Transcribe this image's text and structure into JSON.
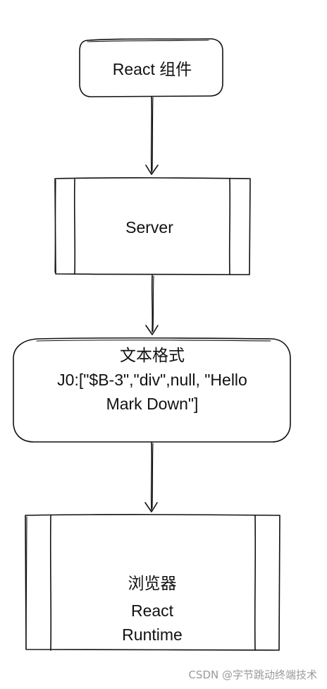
{
  "nodes": [
    {
      "id": "react-component",
      "shape": "rounded-rectangle",
      "lines": [
        "React 组件"
      ]
    },
    {
      "id": "server",
      "shape": "process",
      "lines": [
        "Server"
      ]
    },
    {
      "id": "text-format",
      "shape": "rounded-rectangle",
      "lines": [
        "文本格式",
        "J0:[\"$B-3\",\"div\",null, \"Hello",
        "Mark Down\"]"
      ]
    },
    {
      "id": "browser",
      "shape": "process",
      "lines": [
        "浏览器",
        "React",
        "Runtime"
      ]
    }
  ],
  "edges": [
    {
      "from": "react-component",
      "to": "server"
    },
    {
      "from": "server",
      "to": "text-format"
    },
    {
      "from": "text-format",
      "to": "browser"
    }
  ],
  "watermark": "CSDN @字节跳动终端技术"
}
